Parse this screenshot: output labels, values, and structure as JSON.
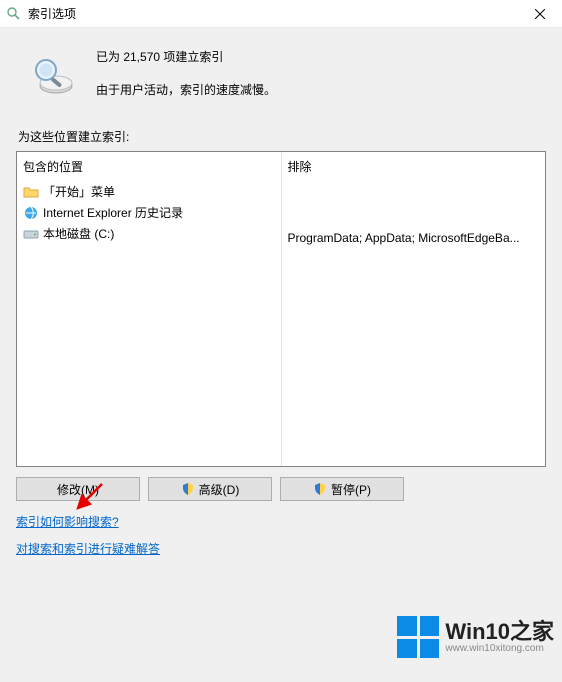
{
  "titlebar": {
    "title": "索引选项"
  },
  "status": {
    "line1": "已为 21,570 项建立索引",
    "line2": "由于用户活动，索引的速度减慢。"
  },
  "section_label": "为这些位置建立索引:",
  "included": {
    "header": "包含的位置",
    "items": [
      {
        "icon": "folder-icon",
        "label": "「开始」菜单"
      },
      {
        "icon": "ie-icon",
        "label": "Internet Explorer 历史记录"
      },
      {
        "icon": "drive-icon",
        "label": "本地磁盘 (C:)"
      }
    ]
  },
  "excluded": {
    "header": "排除",
    "text": "ProgramData; AppData; MicrosoftEdgeBa..."
  },
  "buttons": {
    "modify": "修改(M)",
    "advanced": "高级(D)",
    "pause": "暂停(P)"
  },
  "links": {
    "help1": "索引如何影响搜索?",
    "help2": "对搜索和索引进行疑难解答"
  },
  "watermark": {
    "brand": "Win10之家",
    "url": "www.win10xitong.com"
  }
}
